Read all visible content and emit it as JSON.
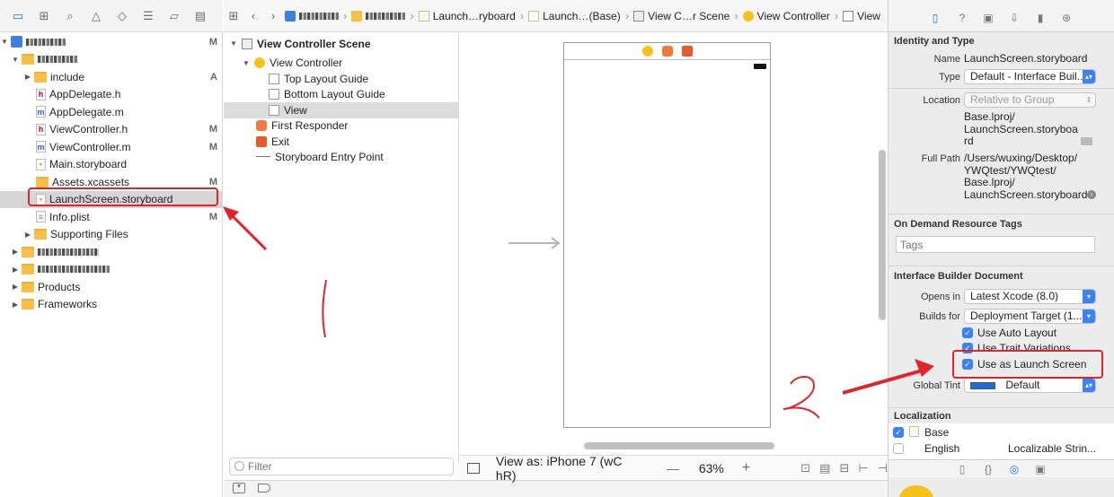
{
  "jumpbar": {
    "crumbs": [
      "Launch…ryboard",
      "Launch…(Base)",
      "View C…r Scene",
      "View Controller",
      "View"
    ]
  },
  "navigator": {
    "items": [
      {
        "label": "include",
        "status": "A"
      },
      {
        "label": "AppDelegate.h",
        "status": ""
      },
      {
        "label": "AppDelegate.m",
        "status": ""
      },
      {
        "label": "ViewController.h",
        "status": "M"
      },
      {
        "label": "ViewController.m",
        "status": "M"
      },
      {
        "label": "Main.storyboard",
        "status": ""
      },
      {
        "label": "Assets.xcassets",
        "status": "M"
      },
      {
        "label": "LaunchScreen.storyboard",
        "status": ""
      },
      {
        "label": "Info.plist",
        "status": "M"
      },
      {
        "label": "Supporting Files",
        "status": ""
      },
      {
        "label": "Products",
        "status": ""
      },
      {
        "label": "Frameworks",
        "status": ""
      }
    ],
    "project_status": "M"
  },
  "outline": {
    "scene": "View Controller Scene",
    "view_controller": "View Controller",
    "top_guide": "Top Layout Guide",
    "bottom_guide": "Bottom Layout Guide",
    "view": "View",
    "first_responder": "First Responder",
    "exit": "Exit",
    "entry_point": "Storyboard Entry Point",
    "filter_placeholder": "Filter"
  },
  "canvas_bar": {
    "view_as": "View as: iPhone 7 (wC hR)",
    "zoom": "63%",
    "minus": "—",
    "plus": "+"
  },
  "inspector": {
    "identity_title": "Identity and Type",
    "name_label": "Name",
    "name_value": "LaunchScreen.storyboard",
    "type_label": "Type",
    "type_value": "Default - Interface Buil...",
    "location_label": "Location",
    "location_value": "Relative to Group",
    "location_path": [
      "Base.lproj/",
      "LaunchScreen.storyboa",
      "rd"
    ],
    "fullpath_label": "Full Path",
    "fullpath_value": [
      "/Users/wuxing/Desktop/",
      "YWQtest/YWQtest/",
      "Base.lproj/",
      "LaunchScreen.storyboard"
    ],
    "odr_title": "On Demand Resource Tags",
    "tags_placeholder": "Tags",
    "ibd_title": "Interface Builder Document",
    "opens_in_label": "Opens in",
    "opens_in_value": "Latest Xcode (8.0)",
    "builds_for_label": "Builds for",
    "builds_for_value": "Deployment Target (1...",
    "use_auto_layout": "Use Auto Layout",
    "use_trait_variations": "Use Trait Variations",
    "use_as_launch": "Use as Launch Screen",
    "global_tint_label": "Global Tint",
    "global_tint_value": "Default",
    "localization_title": "Localization",
    "loc_base": "Base",
    "loc_english": "English",
    "loc_english_value": "Localizable Strin..."
  },
  "colors": {
    "accent": "#3a82f7",
    "annotation": "#e0242a",
    "folder": "#f5c04a",
    "tint_swatch": "#1a6fe0"
  }
}
